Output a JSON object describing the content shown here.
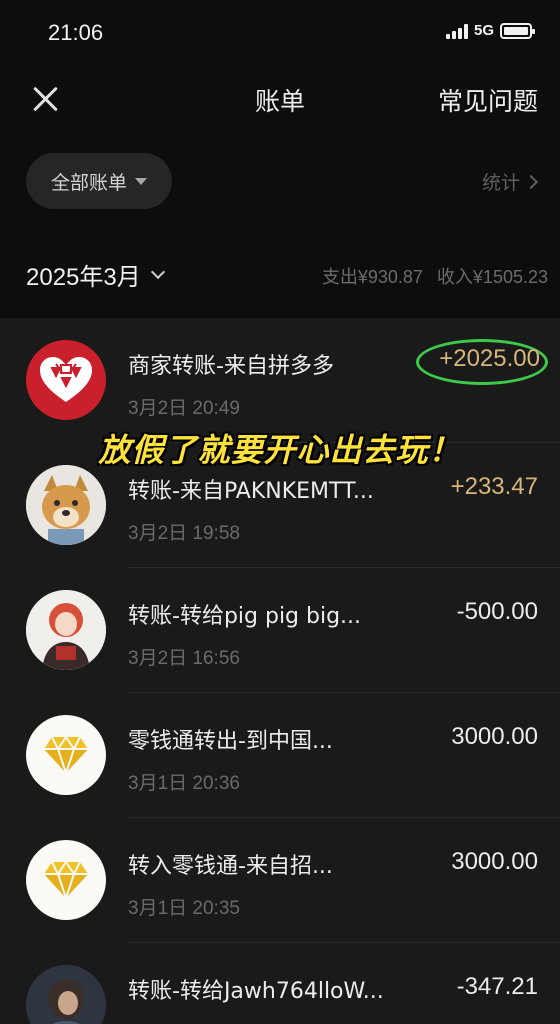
{
  "status_bar": {
    "time": "21:06",
    "network": "5G"
  },
  "nav": {
    "title": "账单",
    "faq_label": "常见问题",
    "close_icon": "close-icon"
  },
  "filter": {
    "all_bills_label": "全部账单",
    "stats_label": "统计"
  },
  "month_header": {
    "month_label": "2025年3月",
    "expense_summary": "支出¥930.87",
    "income_summary": "收入¥1505.23"
  },
  "overlay_caption": "放假了就要开心出去玩！",
  "transactions": [
    {
      "title": "商家转账-来自拼多多",
      "time": "3月2日 20:49",
      "amount": "+2025.00",
      "type": "income",
      "avatar": "pinduoduo-logo",
      "highlighted": true
    },
    {
      "title": "转账-来自PAKNKEMTT...",
      "time": "3月2日 19:58",
      "amount": "+233.47",
      "type": "income",
      "avatar": "dog-avatar"
    },
    {
      "title": "转账-转给pig pig big...",
      "time": "3月2日 16:56",
      "amount": "-500.00",
      "type": "expense",
      "avatar": "girl-avatar"
    },
    {
      "title": "零钱通转出-到中国...",
      "time": "3月1日 20:36",
      "amount": "3000.00",
      "type": "neutral",
      "avatar": "diamond-icon"
    },
    {
      "title": "转入零钱通-来自招...",
      "time": "3月1日 20:35",
      "amount": "3000.00",
      "type": "neutral",
      "avatar": "diamond-icon"
    },
    {
      "title": "转账-转给Jawh764lloW...",
      "time": "",
      "amount": "-347.21",
      "type": "expense",
      "avatar": "dark-avatar"
    }
  ],
  "colors": {
    "background": "#0d0d0d",
    "list_background": "#1a1a1a",
    "income_amount": "#d8b67a",
    "highlight_circle": "#3ec94a",
    "caption": "#ffe23a"
  }
}
